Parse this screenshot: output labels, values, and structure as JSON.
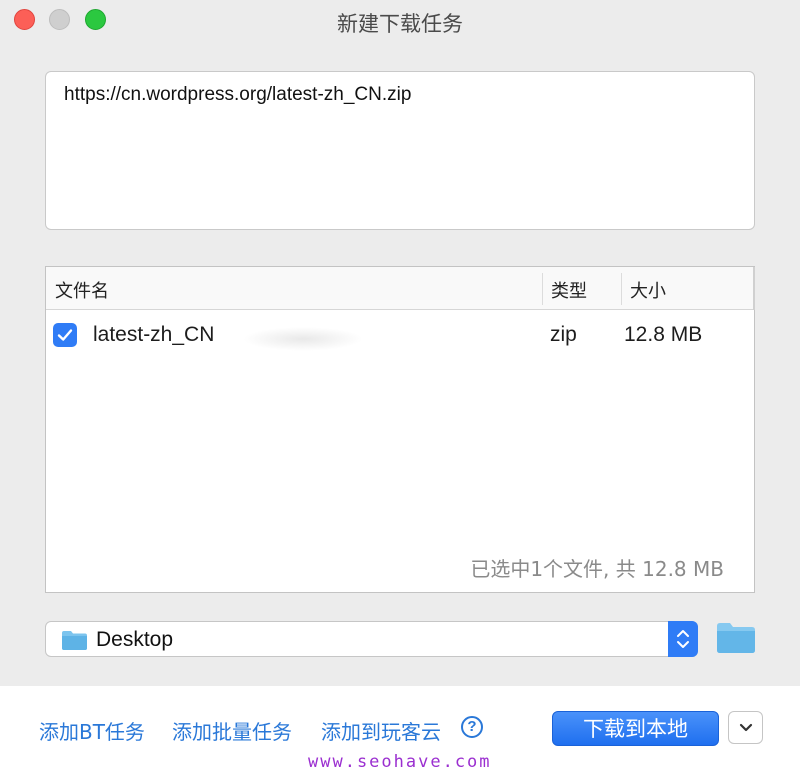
{
  "window": {
    "title": "新建下载任务"
  },
  "url_input": {
    "value": "https://cn.wordpress.org/latest-zh_CN.zip"
  },
  "file_table": {
    "columns": [
      "文件名",
      "类型",
      "大小"
    ],
    "rows": [
      {
        "checked": true,
        "name": "latest-zh_CN",
        "type": "zip",
        "size": "12.8 MB"
      }
    ],
    "summary": "已选中1个文件, 共 12.8 MB"
  },
  "save_path": {
    "label": "Desktop"
  },
  "footer": {
    "link_bt": "添加BT任务",
    "link_batch": "添加批量任务",
    "link_cloud": "添加到玩客云",
    "help_symbol": "?",
    "primary_button": "下载到本地"
  },
  "watermark": "www.seohave.com",
  "colors": {
    "accent": "#2f7cf6",
    "link": "#2a78d8",
    "close": "#fc5f57",
    "maximize": "#2bc840",
    "watermark": "#9b2fd0"
  },
  "icons": [
    "close-icon",
    "minimize-icon",
    "maximize-icon",
    "checkmark-icon",
    "folder-icon",
    "stepper-icon",
    "chevron-down-icon",
    "help-icon"
  ]
}
